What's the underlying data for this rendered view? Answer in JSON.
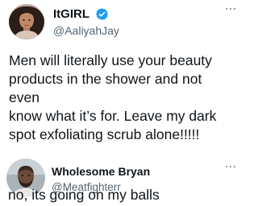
{
  "main_tweet": {
    "display_name": "ItGIRL",
    "handle": "@AaliyahJay",
    "verified": true,
    "text": "Men will literally use your beauty\nproducts in the shower and not even\nknow what it’s for. Leave my dark\nspot exfoliating scrub alone!!!!!",
    "avatar_icon": "profile-photo-woman",
    "more_icon": "more-icon",
    "accent_color": "#1d9bf0"
  },
  "reply_tweet": {
    "display_name": "Wholesome Bryan",
    "handle": "@Meatfighterr",
    "text": "no, its going on my balls",
    "avatar_icon": "profile-photo-man",
    "more_icon": "more-icon"
  }
}
